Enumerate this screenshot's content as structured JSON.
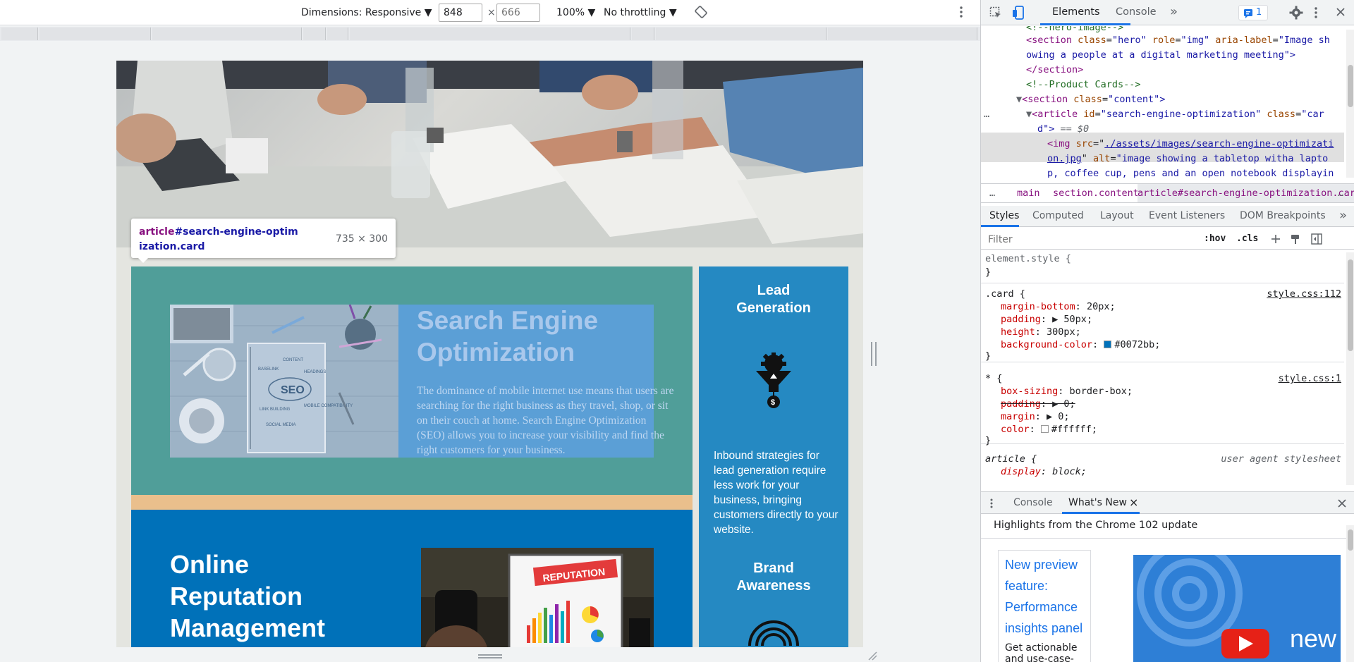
{
  "toolbar": {
    "dimensions_label": "Dimensions: Responsive ▼",
    "width_value": "848",
    "times": "×",
    "height_placeholder": "666",
    "zoom": "100% ▼",
    "throttling": "No throttling ▼"
  },
  "page": {
    "tooltip": {
      "tag": "article",
      "selector_rest": "#search-engine-optimization.card",
      "size": "735 × 300"
    },
    "seo_card": {
      "title": "Search Engine\nOptimization",
      "body": "The dominance of mobile internet use means that users are searching for the right business as they travel, shop, or sit on their couch at home. Search Engine Optimization (SEO) allows you to increase your visibility and find the right customers for your business."
    },
    "orm_card": {
      "title": "Online\nReputation\nManagement",
      "image_label": "REPUTATION"
    },
    "aside": {
      "lead_title": "Lead\nGeneration",
      "lead_text": "Inbound strategies for lead generation require less work for your business, bringing customers directly to your website.",
      "brand_title": "Brand\nAwareness"
    },
    "seo_image_words": {
      "seo": "SEO",
      "content": "CONTENT",
      "baselink": "BASELINK",
      "headings": "HEADINGS",
      "mobile": "MOBILE\nCOMPATIBILITY",
      "link": "LINK BUILDING",
      "social": "SOCIAL\nMEDIA"
    }
  },
  "devtools": {
    "tabs": {
      "elements": "Elements",
      "console": "Console",
      "more": "»",
      "issues_count": "1"
    },
    "dom": {
      "l0": "<!--hero-image-->",
      "l1_open": "<section ",
      "l1_attr1": "class",
      "l1_val1": "\"hero\"",
      "l1_attr2": "role",
      "l1_val2": "\"img\"",
      "l1_attr3": "aria-label",
      "l1_val3": "\"Image sh",
      "l2": "owing a people at a digital marketing meeting\">",
      "l3": "</section>",
      "l4": "<!--Product Cards-->",
      "l5_tag": "<section ",
      "l5_attr": "class",
      "l5_val": "\"content\">",
      "l6_tag": "<article ",
      "l6_attr1": "id",
      "l6_val1": "\"search-engine-optimization\"",
      "l6_attr2": "class",
      "l6_val2": "\"car",
      "l7": "d\">",
      "l7_eq": " == $0",
      "l8_tag": "<img ",
      "l8_attr": "src",
      "l8_link": "./assets/images/search-engine-optimizati",
      "l9_link": "on.jpg",
      "l9_rest_attr": "alt",
      "l9_rest_val": "\"image showing a tabletop witha lapto",
      "l10": "p, coffee cup, pens and an open notebook displayin"
    },
    "breadcrumbs": [
      "…",
      "main",
      "section.content",
      "article#search-engine-optimization.card",
      "…"
    ],
    "subtabs": [
      "Styles",
      "Computed",
      "Layout",
      "Event Listeners",
      "DOM Breakpoints",
      "»"
    ],
    "filter_placeholder": "Filter",
    "filter_hov": ":hov",
    "filter_cls": ".cls",
    "styles": {
      "element_style": "element.style {",
      "close": "}",
      "card_sel": ".card {",
      "card_src": "style.css:112",
      "card_props": [
        {
          "name": "margin-bottom",
          "value": "20px;"
        },
        {
          "name": "padding",
          "value": "▶ 50px;"
        },
        {
          "name": "height",
          "value": "300px;"
        },
        {
          "name": "background-color",
          "value": "#0072bb;"
        }
      ],
      "star_sel": "* {",
      "star_src": "style.css:1",
      "star_props": [
        {
          "name": "box-sizing",
          "value": "border-box;"
        },
        {
          "name": "padding",
          "value": "▶ 0;"
        },
        {
          "name": "margin",
          "value": "▶ 0;"
        },
        {
          "name": "color",
          "value": "#ffffff;"
        }
      ],
      "article_sel": "article {",
      "article_src": "user agent stylesheet",
      "article_prop": "display",
      "article_val": "block;"
    },
    "drawer": {
      "console": "Console",
      "whats_new": "What's New",
      "close_tab": "×"
    },
    "whats_new": {
      "heading": "Highlights from the Chrome 102 update",
      "card_title": "New preview\nfeature:\nPerformance\ninsights panel",
      "card_desc": "Get actionable and use-case-",
      "video_word": "new"
    }
  },
  "colors": {
    "card_bg": "#0072bb",
    "seo_card": "#509e99",
    "aside": "#2589c2",
    "peach": "#eabf8c",
    "accent": "#1a73e8"
  }
}
